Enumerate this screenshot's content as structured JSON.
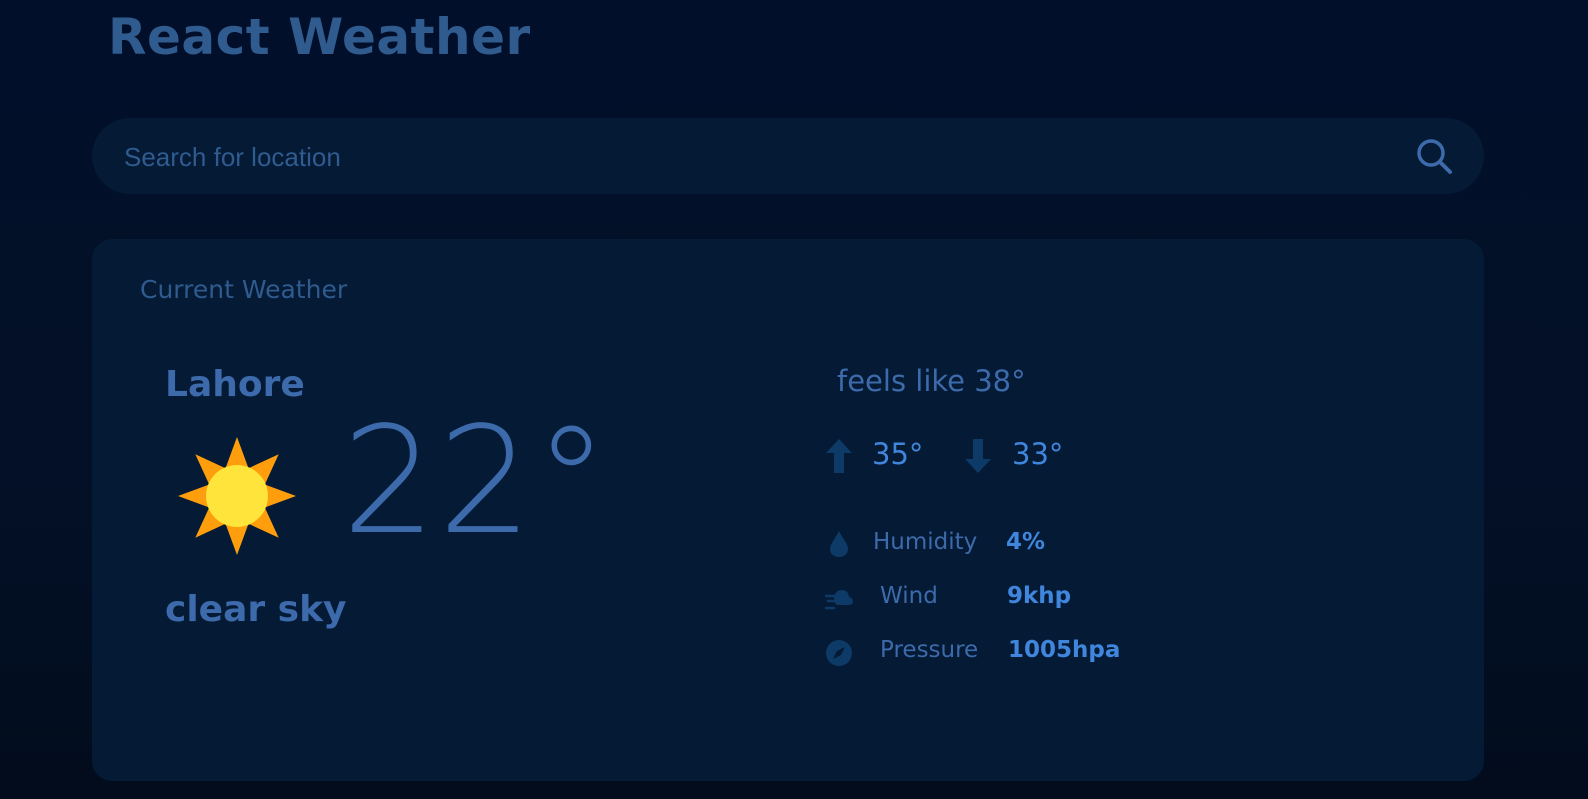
{
  "app": {
    "title": "React Weather"
  },
  "search": {
    "placeholder": "Search for location",
    "icon": "search-icon"
  },
  "current_weather": {
    "heading": "Current Weather",
    "city": "Lahore",
    "temperature": "22°",
    "description": "clear sky",
    "icon": "sun-icon",
    "feels_like": "feels like 38°",
    "max_temp": "35°",
    "min_temp": "33°",
    "details": [
      {
        "label": "Humidity",
        "value": "4%",
        "icon": "water-drop-icon"
      },
      {
        "label": "Wind",
        "value": "9khp",
        "icon": "wind-icon"
      },
      {
        "label": "Pressure",
        "value": "1005hpa",
        "icon": "compass-icon"
      }
    ]
  },
  "colors": {
    "background": "#020f2a",
    "card": "#041a35",
    "title": "#2f5b8f",
    "text": "#3d6aab",
    "accent": "#3f86dc",
    "sun_outer": "#ff9e0d",
    "sun_inner": "#ffe53b"
  }
}
